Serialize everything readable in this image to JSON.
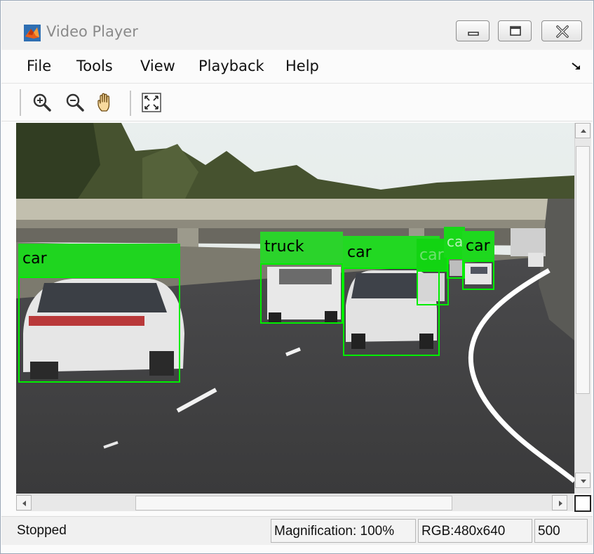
{
  "window": {
    "title": "Video Player"
  },
  "menu": {
    "items": [
      "File",
      "Tools",
      "View",
      "Playback",
      "Help"
    ]
  },
  "toolbar": {
    "icons": [
      "zoom-in-icon",
      "zoom-out-icon",
      "pan-hand-icon",
      "fit-to-window-icon"
    ]
  },
  "video": {
    "detections": [
      {
        "label": "car"
      },
      {
        "label": "truck"
      },
      {
        "label": "car"
      },
      {
        "label": "car"
      },
      {
        "label": "ca"
      },
      {
        "label": "car"
      }
    ],
    "detection_color": "#00ee00"
  },
  "status": {
    "state": "Stopped",
    "magnification": "Magnification: 100%",
    "dimensions": "RGB:480x640",
    "frame": "500"
  }
}
